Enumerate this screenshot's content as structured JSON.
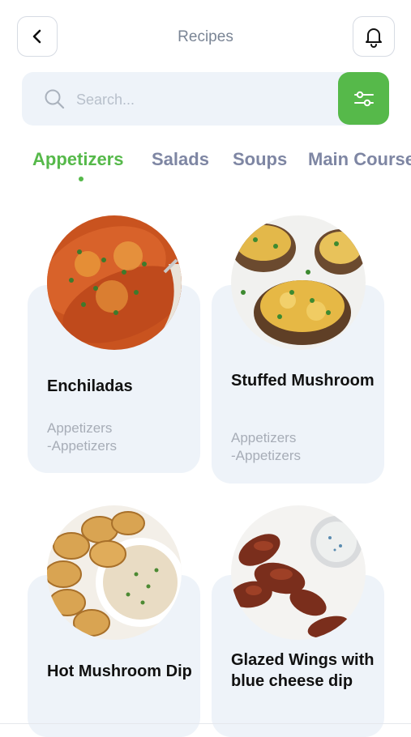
{
  "header": {
    "title": "Recipes"
  },
  "search": {
    "placeholder": "Search..."
  },
  "tabs": [
    {
      "label": "Appetizers",
      "active": true
    },
    {
      "label": "Salads",
      "active": false
    },
    {
      "label": "Soups",
      "active": false
    },
    {
      "label": "Main Course",
      "active": false
    }
  ],
  "recipes": [
    {
      "title": "Enchiladas",
      "category1": "Appetizers",
      "category2": "-Appetizers"
    },
    {
      "title": "Stuffed Mushroom",
      "category1": "Appetizers",
      "category2": "-Appetizers"
    },
    {
      "title": "Hot Mushroom Dip",
      "category1": "",
      "category2": ""
    },
    {
      "title": "Glazed Wings with blue cheese dip",
      "category1": "",
      "category2": ""
    }
  ],
  "colors": {
    "accent": "#56b94a",
    "tab_inactive": "#7e86a3",
    "card_bg": "#eef3f9"
  },
  "icons": {
    "back": "chevron-left-icon",
    "notify": "bell-icon",
    "search": "search-icon",
    "filter": "sliders-icon"
  }
}
